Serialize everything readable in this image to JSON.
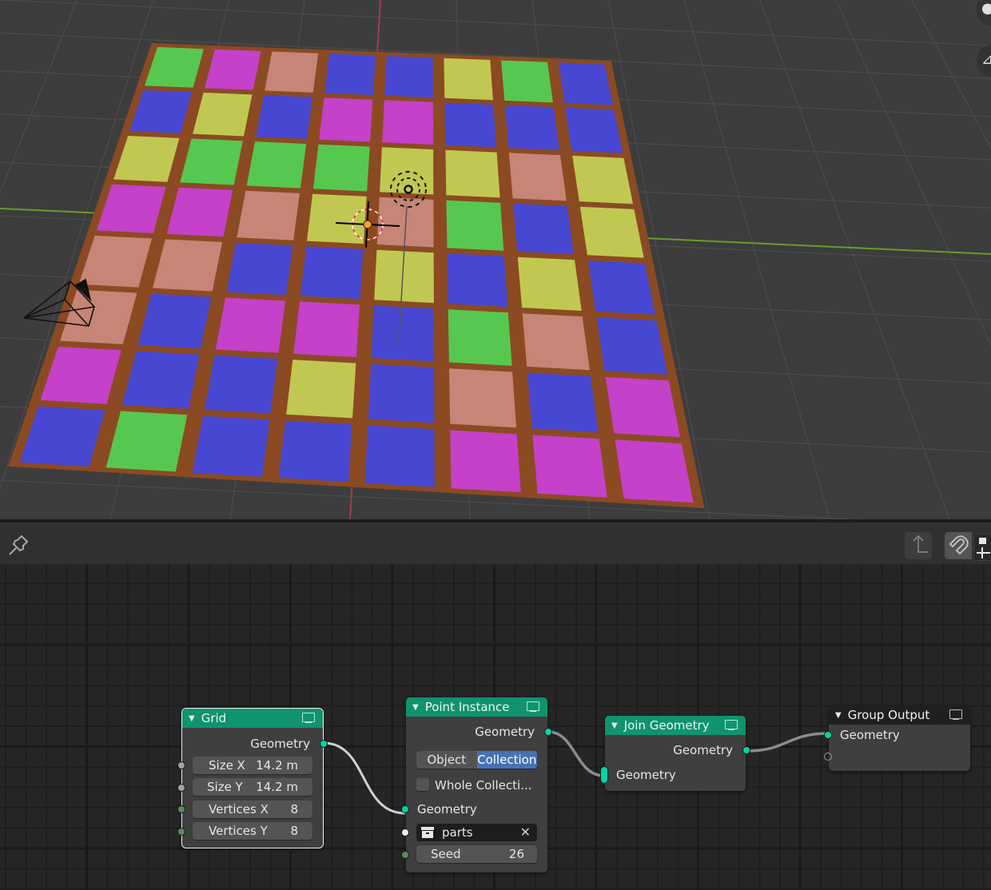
{
  "viewport": {
    "background": "#3d3d3d",
    "grid_line_color": "#4a4a4a",
    "x_axis_color": "#a33a4d",
    "y_axis_color": "#6e9a2a",
    "mesh_edge_color": "#8b4a22",
    "tile_palette": {
      "G": "#57c84f",
      "M": "#c541c9",
      "S": "#c68576",
      "B": "#4747d1",
      "Y": "#c0c852"
    },
    "grid_rows": 8,
    "grid_cols": 8,
    "tile_colors": [
      [
        "G",
        "M",
        "S",
        "B",
        "B",
        "Y",
        "G",
        "B"
      ],
      [
        "B",
        "Y",
        "B",
        "M",
        "M",
        "B",
        "B",
        "B"
      ],
      [
        "Y",
        "G",
        "G",
        "G",
        "Y",
        "Y",
        "S",
        "Y"
      ],
      [
        "M",
        "M",
        "S",
        "Y",
        "S",
        "G",
        "B",
        "Y"
      ],
      [
        "S",
        "S",
        "B",
        "B",
        "Y",
        "B",
        "Y",
        "B"
      ],
      [
        "S",
        "B",
        "M",
        "M",
        "B",
        "G",
        "S",
        "B"
      ],
      [
        "M",
        "B",
        "B",
        "Y",
        "B",
        "S",
        "B",
        "M"
      ],
      [
        "B",
        "G",
        "B",
        "B",
        "B",
        "M",
        "M",
        "M"
      ]
    ],
    "objects": [
      "camera-icon",
      "light-icon",
      "3d-cursor-icon",
      "origin-point"
    ],
    "gizmo_buttons": [
      {
        "icon": "zoom-icon",
        "glyph": "●"
      },
      {
        "icon": "camera-view-icon",
        "glyph": "⊿"
      }
    ]
  },
  "node_header": {
    "pin_icon": "pin-icon",
    "parent_icon": "parent-node-tree-icon",
    "snap_icon": "magnet-snap-icon",
    "sidebar_icon": "sidebar-plus-icon"
  },
  "nodes": {
    "grid": {
      "title": "Grid",
      "output": "Geometry",
      "fields": [
        {
          "label": "Size X",
          "value": "14.2 m"
        },
        {
          "label": "Size Y",
          "value": "14.2 m"
        },
        {
          "label": "Vertices X",
          "value": "8"
        },
        {
          "label": "Vertices Y",
          "value": "8"
        }
      ]
    },
    "point_instance": {
      "title": "Point Instance",
      "output": "Geometry",
      "mode_options": [
        "Object",
        "Collection"
      ],
      "mode_selected": "Collection",
      "whole_collection_label": "Whole Collecti...",
      "whole_collection_checked": false,
      "input_geometry": "Geometry",
      "collection_value": "parts",
      "seed_label": "Seed",
      "seed_value": "26"
    },
    "join_geometry": {
      "title": "Join Geometry",
      "output": "Geometry",
      "input": "Geometry"
    },
    "group_output": {
      "title": "Group Output",
      "input": "Geometry"
    }
  },
  "colors": {
    "node_header": "#0f946f",
    "geometry_socket": "#00d6a3",
    "selected_enum": "#4772b3"
  }
}
